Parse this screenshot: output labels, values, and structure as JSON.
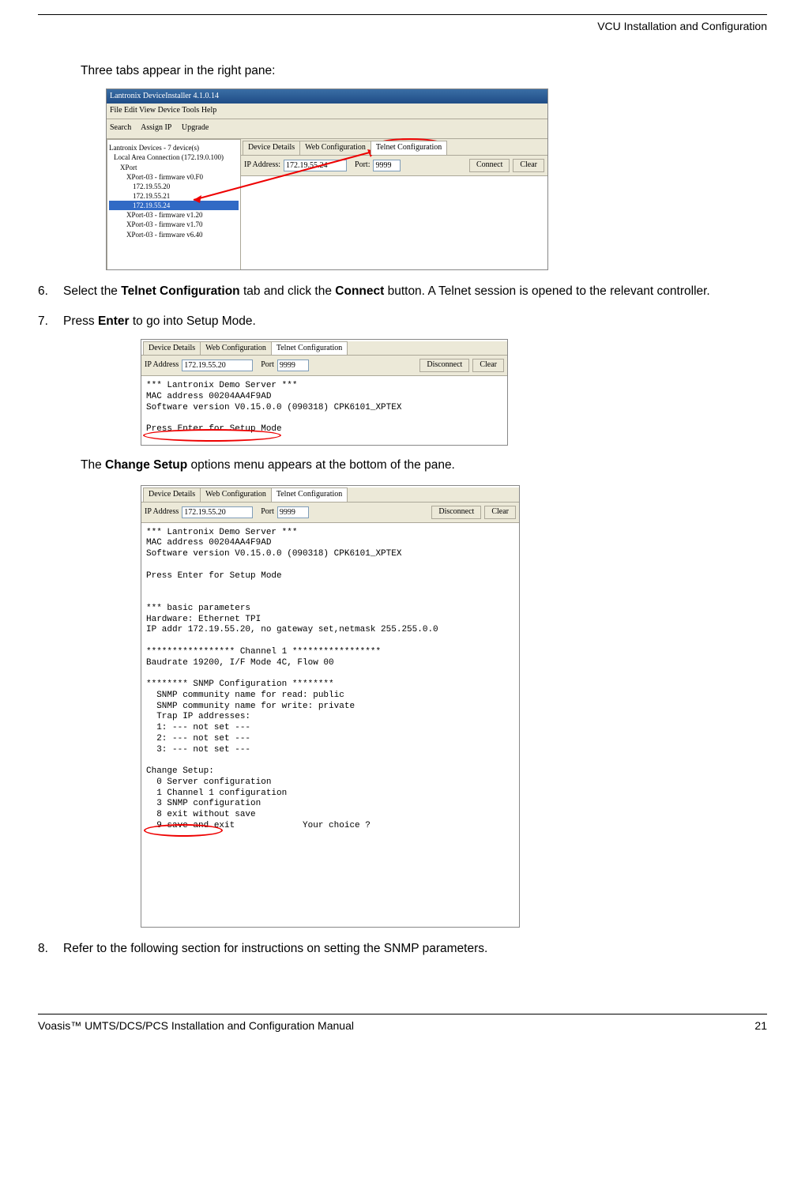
{
  "header": {
    "title": "VCU Installation and Configuration"
  },
  "intro": "Three tabs appear in the right pane:",
  "step6": {
    "num": "6.",
    "pre": "Select the ",
    "b1": "Telnet Configuration",
    "mid": " tab and click the ",
    "b2": "Connect",
    "post": " button. A Telnet session is opened to the relevant controller."
  },
  "step7": {
    "num": "7.",
    "pre": "Press ",
    "b1": "Enter",
    "post": " to go into Setup Mode."
  },
  "afterSS2": {
    "pre": "The ",
    "b1": "Change Setup",
    "post": " options menu appears at the bottom of the pane."
  },
  "step8": {
    "num": "8.",
    "text": "Refer to the following section for instructions on setting the SNMP parameters."
  },
  "footer": {
    "left": "Voasis™ UMTS/DCS/PCS Installation and Configuration Manual",
    "right": "21"
  },
  "ss1": {
    "title": "Lantronix DeviceInstaller 4.1.0.14",
    "menu": "File   Edit   View   Device   Tools   Help",
    "tool1": "Search",
    "tool2": "Assign IP",
    "tool3": "Upgrade",
    "tree_root": "Lantronix Devices - 7 device(s)",
    "tree_lan": "Local Area Connection (172.19.0.100)",
    "tree_xport": "XPort",
    "tree_fw": "XPort-03 - firmware v0.F0",
    "tree_ip1": "172.19.55.20",
    "tree_ip2": "172.19.55.21",
    "tree_ip3": "172.19.55.24",
    "tree_fw2": "XPort-03 - firmware v1.20",
    "tree_fw3": "XPort-03 - firmware v1.70",
    "tree_fw4": "XPort-03 - firmware v6.40",
    "tab1": "Device Details",
    "tab2": "Web Configuration",
    "tab3": "Telnet Configuration",
    "lbl_ip": "IP Address:",
    "ip": "172.19.55.24",
    "lbl_port": "Port:",
    "port": "9999",
    "btn_connect": "Connect",
    "btn_clear": "Clear"
  },
  "ss2": {
    "tab1": "Device Details",
    "tab2": "Web Configuration",
    "tab3": "Telnet Configuration",
    "lbl_ip": "IP Address",
    "ip": "172.19.55.20",
    "lbl_port": "Port",
    "port": "9999",
    "btn_disc": "Disconnect",
    "btn_clear": "Clear",
    "console": "*** Lantronix Demo Server ***\nMAC address 00204AA4F9AD\nSoftware version V0.15.0.0 (090318) CPK6101_XPTEX\n\nPress Enter for Setup Mode"
  },
  "ss3": {
    "tab1": "Device Details",
    "tab2": "Web Configuration",
    "tab3": "Telnet Configuration",
    "lbl_ip": "IP Address",
    "ip": "172.19.55.20",
    "lbl_port": "Port",
    "port": "9999",
    "btn_disc": "Disconnect",
    "btn_clear": "Clear",
    "console": "*** Lantronix Demo Server ***\nMAC address 00204AA4F9AD\nSoftware version V0.15.0.0 (090318) CPK6101_XPTEX\n\nPress Enter for Setup Mode\n\n\n*** basic parameters\nHardware: Ethernet TPI\nIP addr 172.19.55.20, no gateway set,netmask 255.255.0.0\n\n***************** Channel 1 *****************\nBaudrate 19200, I/F Mode 4C, Flow 00\n\n******** SNMP Configuration ********\n  SNMP community name for read: public\n  SNMP community name for write: private\n  Trap IP addresses:\n  1: --- not set ---\n  2: --- not set ---\n  3: --- not set ---\n\nChange Setup:\n  0 Server configuration\n  1 Channel 1 configuration\n  3 SNMP configuration\n  8 exit without save\n  9 save and exit             Your choice ?"
  }
}
